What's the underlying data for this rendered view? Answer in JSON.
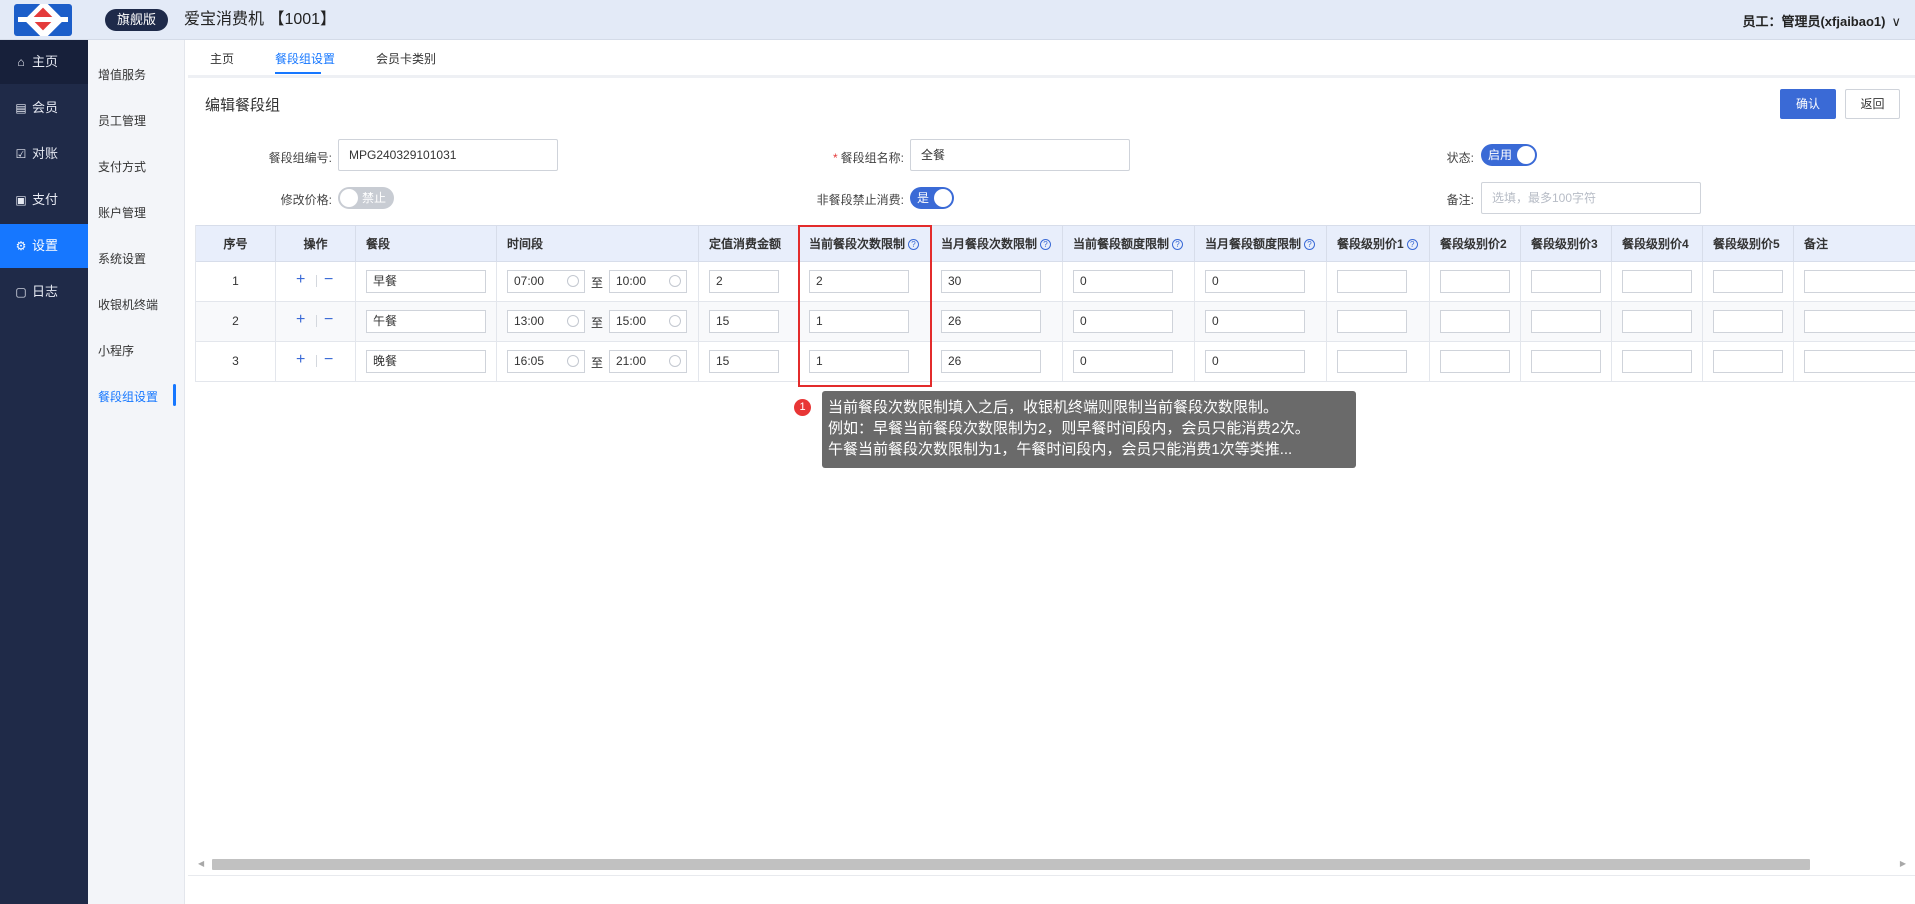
{
  "header": {
    "edition_badge": "旗舰版",
    "app_title": "爱宝消费机 【1001】",
    "user_label": "员工：管理员(xfjaibao1)",
    "user_chevron": "∨"
  },
  "leftnav": {
    "items": [
      {
        "label": "主页",
        "icon": "home-icon",
        "glyph": "⌂"
      },
      {
        "label": "会员",
        "icon": "member-icon",
        "glyph": "▤"
      },
      {
        "label": "对账",
        "icon": "reconcile-icon",
        "glyph": "☑"
      },
      {
        "label": "支付",
        "icon": "payment-icon",
        "glyph": "▣"
      },
      {
        "label": "设置",
        "icon": "gear-icon",
        "glyph": "⚙"
      },
      {
        "label": "日志",
        "icon": "log-icon",
        "glyph": "▢"
      }
    ]
  },
  "subnav": {
    "items": [
      {
        "label": "增值服务"
      },
      {
        "label": "员工管理"
      },
      {
        "label": "支付方式"
      },
      {
        "label": "账户管理"
      },
      {
        "label": "系统设置"
      },
      {
        "label": "收银机终端"
      },
      {
        "label": "小程序"
      },
      {
        "label": "餐段组设置"
      }
    ]
  },
  "tabs": [
    {
      "label": "主页"
    },
    {
      "label": "餐段组设置"
    },
    {
      "label": "会员卡类别"
    }
  ],
  "page": {
    "title": "编辑餐段组",
    "confirm_label": "确认",
    "back_label": "返回"
  },
  "form": {
    "group_no_label": "餐段组编号:",
    "group_no_value": "MPG240329101031",
    "group_name_required": "*",
    "group_name_label": "餐段组名称:",
    "group_name_value": "全餐",
    "status_label": "状态:",
    "status_value": "启用",
    "modify_price_label": "修改价格:",
    "modify_price_value": "禁止",
    "non_meal_label": "非餐段禁止消费:",
    "non_meal_value": "是",
    "remark_label": "备注:",
    "remark_placeholder": "选填，最多100字符"
  },
  "table": {
    "headers": {
      "seq": "序号",
      "op": "操作",
      "meal": "餐段",
      "period": "时间段",
      "fixed_amount": "定值消费金额",
      "meal_count_limit": "当前餐段次数限制",
      "month_count_limit": "当月餐段次数限制",
      "meal_amount_limit": "当前餐段额度限制",
      "month_amount_limit": "当月餐段额度限制",
      "level_price_1": "餐段级别价1",
      "level_price_2": "餐段级别价2",
      "level_price_3": "餐段级别价3",
      "level_price_4": "餐段级别价4",
      "level_price_5": "餐段级别价5",
      "remark": "备注"
    },
    "help_glyph": "?",
    "plus": "+",
    "minus": "−",
    "to_text": "至",
    "rows": [
      {
        "seq": "1",
        "meal": "早餐",
        "start": "07:00",
        "end": "10:00",
        "fixed": "2",
        "meal_count": "2",
        "month_count": "30",
        "meal_amount": "0",
        "month_amount": "0"
      },
      {
        "seq": "2",
        "meal": "午餐",
        "start": "13:00",
        "end": "15:00",
        "fixed": "15",
        "meal_count": "1",
        "month_count": "26",
        "meal_amount": "0",
        "month_amount": "0"
      },
      {
        "seq": "3",
        "meal": "晚餐",
        "start": "16:05",
        "end": "21:00",
        "fixed": "15",
        "meal_count": "1",
        "month_count": "26",
        "meal_amount": "0",
        "month_amount": "0"
      }
    ]
  },
  "annotation": {
    "marker": "1",
    "lines": [
      "当前餐段次数限制填入之后，收银机终端则限制当前餐段次数限制。",
      "例如：早餐当前餐段次数限制为2，则早餐时间段内，会员只能消费2次。",
      "午餐当前餐段次数限制为1，午餐时间段内，会员只能消费1次等类推..."
    ]
  },
  "colors": {
    "accent": "#1677ff",
    "nav_bg": "#1f2a48",
    "highlight": "#e32b2b",
    "tooltip_bg": "#6a6a6a"
  }
}
